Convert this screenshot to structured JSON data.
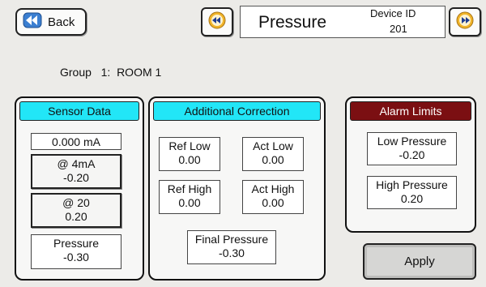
{
  "header": {
    "back_label": "Back",
    "title": "Pressure",
    "device_id_label": "Device ID",
    "device_id_value": "201"
  },
  "group": {
    "label": "Group",
    "number": "1:",
    "name": "ROOM 1"
  },
  "sensor_data": {
    "title": "Sensor Data",
    "current": "0.000 mA",
    "at_4ma_label": "@ 4mA",
    "at_4ma_value": "-0.20",
    "at_20_label": "@ 20",
    "at_20_value": "0.20",
    "pressure_label": "Pressure",
    "pressure_value": "-0.30"
  },
  "additional_correction": {
    "title": "Additional Correction",
    "ref_low_label": "Ref Low",
    "ref_low_value": "0.00",
    "act_low_label": "Act Low",
    "act_low_value": "0.00",
    "ref_high_label": "Ref High",
    "ref_high_value": "0.00",
    "act_high_label": "Act High",
    "act_high_value": "0.00",
    "final_pressure_label": "Final Pressure",
    "final_pressure_value": "-0.30"
  },
  "alarm_limits": {
    "title": "Alarm Limits",
    "low_label": "Low Pressure",
    "low_value": "-0.20",
    "high_label": "High Pressure",
    "high_value": "0.20"
  },
  "apply_label": "Apply",
  "colors": {
    "cyan_header": "#22e6f7",
    "alarm_header": "#7b0f12",
    "nav_icon": "#f0b429",
    "back_icon": "#3b7fd1"
  },
  "icons": {
    "back": "back-arrow-icon",
    "prev": "rewind-icon",
    "next": "fast-forward-icon"
  }
}
